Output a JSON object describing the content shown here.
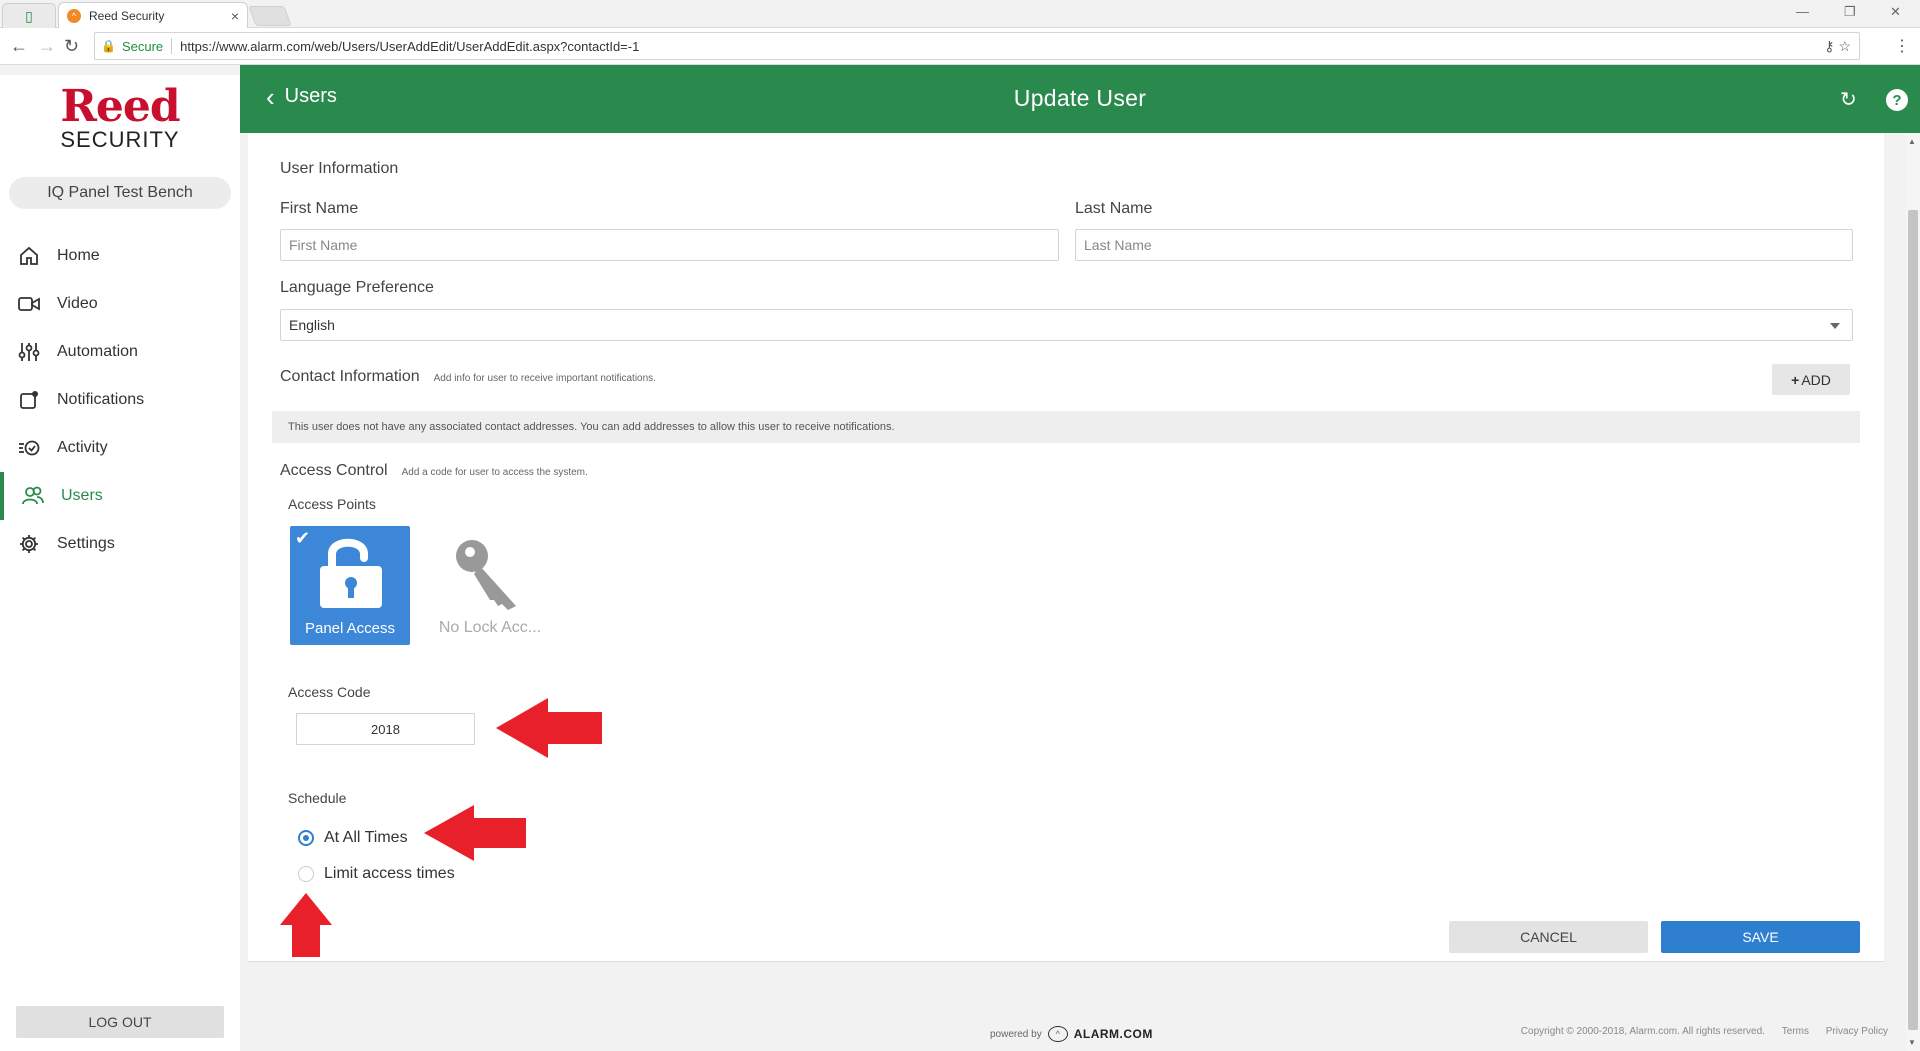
{
  "browser": {
    "tab_title": "Reed Security",
    "secure_label": "Secure",
    "url": "https://www.alarm.com/web/Users/UserAddEdit/UserAddEdit.aspx?contactId=-1"
  },
  "sidebar": {
    "logo_top": "Reed",
    "logo_bottom": "SECURITY",
    "panel_name": "IQ Panel Test Bench",
    "items": [
      {
        "label": "Home",
        "icon": "home-icon"
      },
      {
        "label": "Video",
        "icon": "video-icon"
      },
      {
        "label": "Automation",
        "icon": "automation-icon"
      },
      {
        "label": "Notifications",
        "icon": "notifications-icon"
      },
      {
        "label": "Activity",
        "icon": "activity-icon"
      },
      {
        "label": "Users",
        "icon": "users-icon",
        "active": true
      },
      {
        "label": "Settings",
        "icon": "settings-icon"
      }
    ],
    "logout": "LOG OUT"
  },
  "header": {
    "back_label": "Users",
    "title": "Update User"
  },
  "form": {
    "user_info_title": "User Information",
    "first_name_label": "First Name",
    "first_name_placeholder": "First Name",
    "last_name_label": "Last Name",
    "last_name_placeholder": "Last Name",
    "language_label": "Language Preference",
    "language_value": "English",
    "contact_title": "Contact Information",
    "contact_sub": "Add info for user to receive important notifications.",
    "add_label": "ADD",
    "contact_notice": "This user does not have any associated contact addresses. You can add addresses to allow this user to receive notifications.",
    "access_title": "Access Control",
    "access_sub": "Add a code for user to access the system.",
    "access_points_label": "Access Points",
    "tile_panel": "Panel Access",
    "tile_lock": "No Lock Acc...",
    "access_code_label": "Access Code",
    "access_code_value": "2018",
    "schedule_label": "Schedule",
    "schedule_opt1": "At All Times",
    "schedule_opt2": "Limit access times",
    "schedule_selected": "At All Times",
    "cancel": "CANCEL",
    "save": "SAVE"
  },
  "footer": {
    "powered_by": "powered by",
    "brand": "ALARM.COM",
    "copyright": "Copyright © 2000-2018, Alarm.com. All rights reserved.",
    "terms": "Terms",
    "privacy": "Privacy Policy"
  },
  "colors": {
    "header_green": "#2a8a4e",
    "primary_blue": "#2f7fd0",
    "annotation_red": "#e8202a",
    "logo_red": "#c8102e"
  }
}
